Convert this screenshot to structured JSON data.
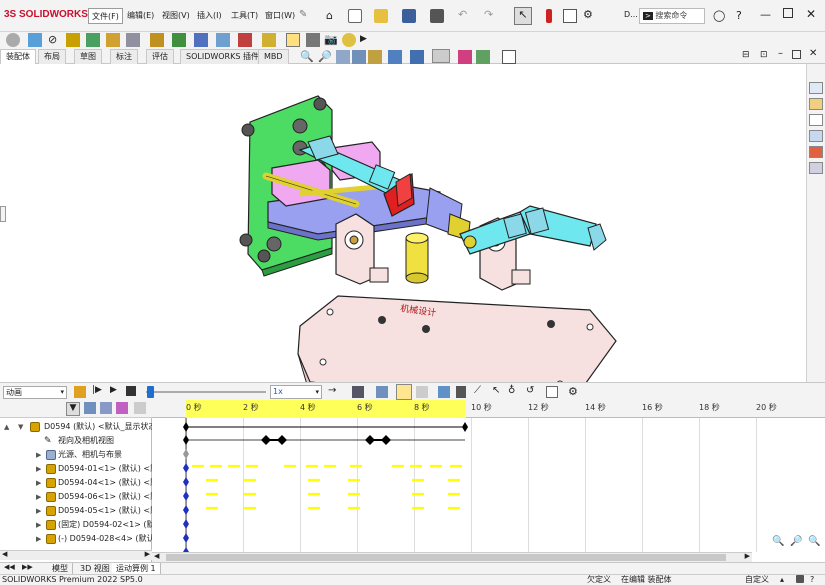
{
  "app": {
    "logo": "SOLIDWORKS",
    "logo_prefix": "3S"
  },
  "menu": [
    {
      "label": "文件(F)"
    },
    {
      "label": "编辑(E)"
    },
    {
      "label": "视图(V)"
    },
    {
      "label": "插入(I)"
    },
    {
      "label": "工具(T)"
    },
    {
      "label": "窗口(W)"
    }
  ],
  "search": {
    "placeholder": "搜索命令",
    "prefix": "D..."
  },
  "tabs": [
    {
      "label": "装配体"
    },
    {
      "label": "布局"
    },
    {
      "label": "草图"
    },
    {
      "label": "标注"
    },
    {
      "label": "评估"
    },
    {
      "label": "SOLIDWORKS 插件"
    },
    {
      "label": "MBD"
    }
  ],
  "model": {
    "stamp_text": "机械设计"
  },
  "motion": {
    "study_type": "动画",
    "speed": "1x",
    "ruler_ticks": [
      "0 秒",
      "2 秒",
      "4 秒",
      "6 秒",
      "8 秒",
      "10 秒",
      "12 秒",
      "14 秒",
      "16 秒",
      "18 秒",
      "20 秒"
    ]
  },
  "tree": [
    {
      "label": "D0594 (默认) <默认_显示状态",
      "icon": "assembly-icon",
      "indent": 0
    },
    {
      "label": "视向及相机视图",
      "icon": "camera-icon",
      "indent": 1
    },
    {
      "label": "光源、相机与布景",
      "icon": "lights-icon",
      "indent": 1
    },
    {
      "label": "D0594-01<1> (默认) <默",
      "icon": "part-icon",
      "indent": 1
    },
    {
      "label": "D0594-04<1> (默认) <默",
      "icon": "part-icon",
      "indent": 1
    },
    {
      "label": "D0594-06<1> (默认) <默",
      "icon": "part-icon",
      "indent": 1
    },
    {
      "label": "D0594-05<1> (默认) <默",
      "icon": "part-icon",
      "indent": 1
    },
    {
      "label": "(固定) D0594-02<1> (默认",
      "icon": "part-icon",
      "indent": 1
    },
    {
      "label": "(-) D0594-028<4> (默认)",
      "icon": "part-icon",
      "indent": 1
    }
  ],
  "bottom_tabs": [
    {
      "label": "模型"
    },
    {
      "label": "3D 视图"
    },
    {
      "label": "运动算例 1"
    }
  ],
  "status": {
    "app_version": "SOLIDWORKS Premium 2022 SP5.0",
    "definition": "欠定义",
    "editing": "在编辑 装配体",
    "units": "自定义"
  },
  "colors": {
    "plate_green": "#4ddc63",
    "base_pink": "#f7dede",
    "cyan": "#6fe7ee",
    "magenta": "#f0a8f0",
    "lavender": "#9aa0f0",
    "yellow": "#f0e040",
    "red": "#e02020",
    "timeline_yellow": "#ffff00"
  }
}
